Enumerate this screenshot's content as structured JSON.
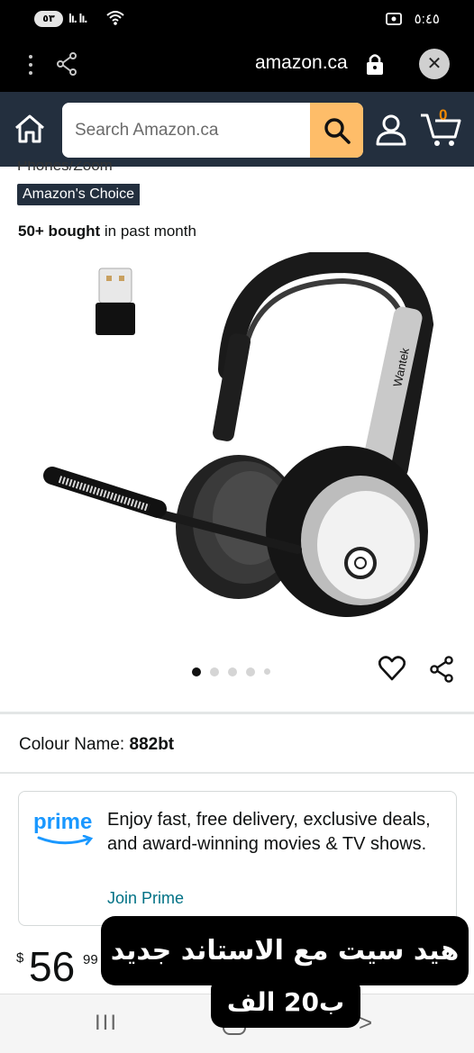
{
  "status_bar": {
    "battery": "٥٣",
    "signal_1": "lı. lı.",
    "time": "٥:٤٥"
  },
  "browser": {
    "url": "amazon.ca"
  },
  "header": {
    "search_placeholder": "Search Amazon.ca",
    "cart_count": "0",
    "accent_color": "#febd69",
    "bar_color": "#232f3e"
  },
  "product": {
    "partial_line": "Phones/Zoom",
    "badge": "Amazon's Choice",
    "bought_bold": "50+ bought",
    "bought_rest": " in past month",
    "image_brand": "Wantek",
    "carousel_dots": 5,
    "carousel_active_index": 0,
    "colour_label": "Colour Name: ",
    "colour_value": "882bt"
  },
  "prime": {
    "logo_word": "prime",
    "text": "Enjoy fast, free delivery, exclusive deals, and award-winning movies & TV shows.",
    "link": "Join Prime",
    "color": "#1a98ff"
  },
  "price": {
    "symbol": "$",
    "whole": "56",
    "fraction": "99"
  },
  "overlay": {
    "line1": "هيد سيت مع الاستاند جديد",
    "line2": "ب20 الف"
  },
  "nav": {
    "recent": "III",
    "back": ">"
  }
}
